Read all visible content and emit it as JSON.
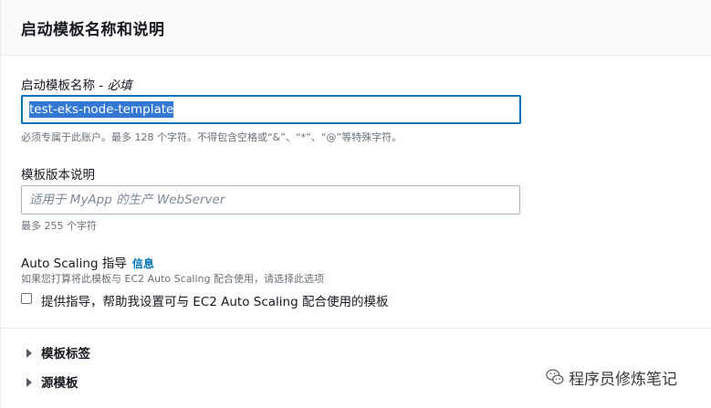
{
  "header": {
    "title": "启动模板名称和说明"
  },
  "template_name": {
    "label": "启动模板名称",
    "required_suffix": " - 必填",
    "value": "test-eks-node-template",
    "hint": "必须专属于此账户。最多 128 个字符。不得包含空格或“&”、“*”、“@”等特殊字符。"
  },
  "version_description": {
    "label": "模板版本说明",
    "placeholder": "适用于 MyApp 的生产 WebServer",
    "hint": "最多 255 个字符"
  },
  "auto_scaling": {
    "label": "Auto Scaling 指导",
    "info_link": "信息",
    "hint": "如果您打算将此模板与 EC2 Auto Scaling 配合使用，请选择此选项",
    "checkbox_label": "提供指导，帮助我设置可与 EC2 Auto Scaling 配合使用的模板",
    "checked": false
  },
  "sections": [
    {
      "label": "模板标签"
    },
    {
      "label": "源模板"
    }
  ],
  "watermark": {
    "text": "程序员修炼笔记",
    "icon": "wechat-icon"
  }
}
